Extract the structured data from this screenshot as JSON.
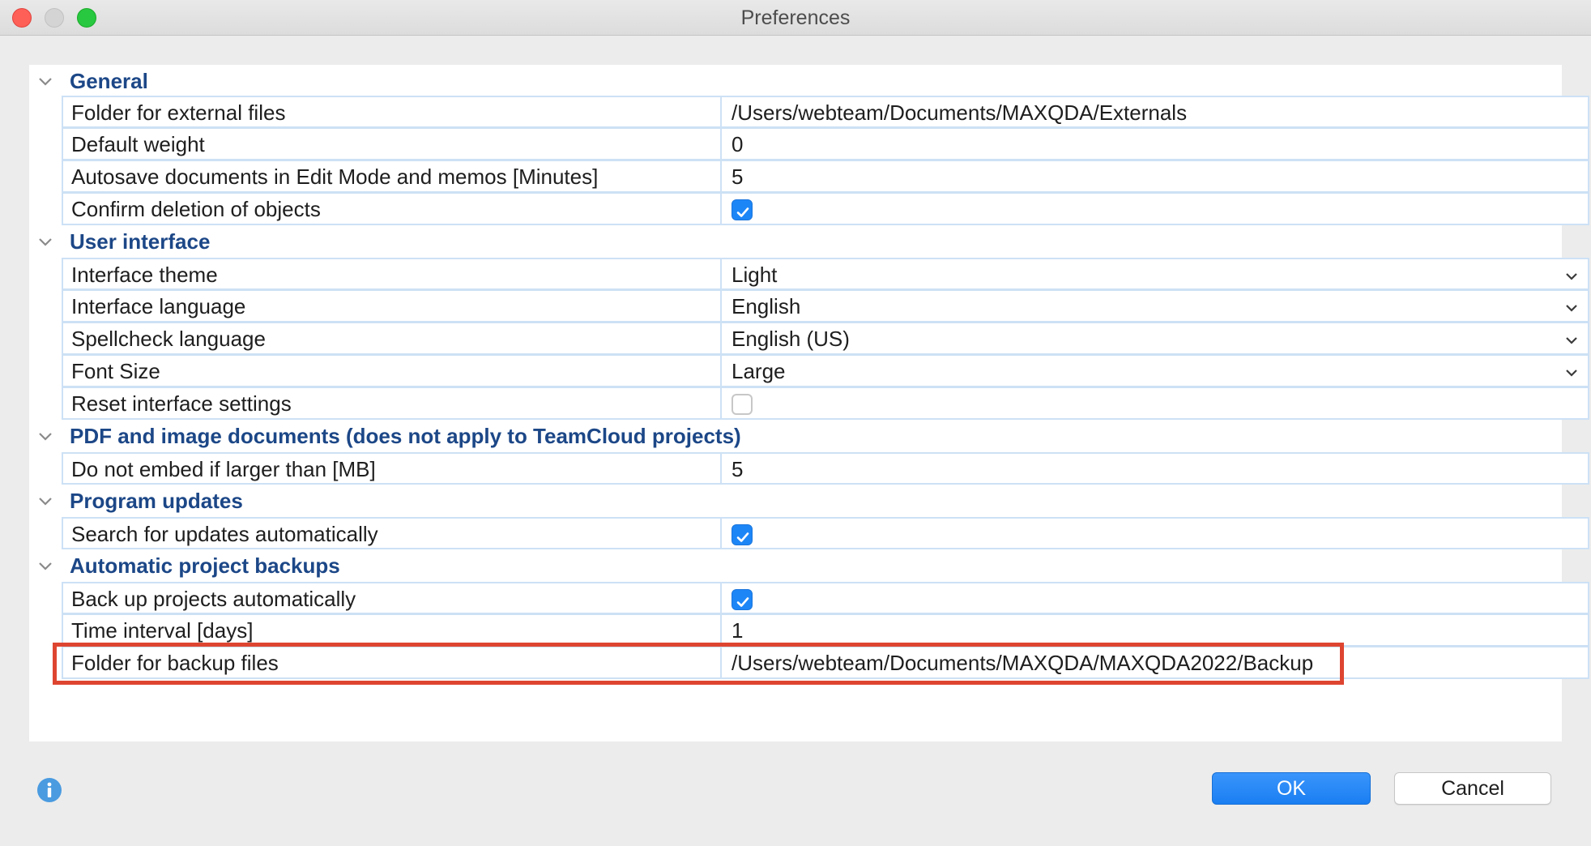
{
  "window": {
    "title": "Preferences"
  },
  "sections": {
    "general": {
      "title": "General",
      "rows": [
        {
          "label": "Folder for external files",
          "value": "/Users/webteam/Documents/MAXQDA/Externals"
        },
        {
          "label": "Default weight",
          "value": "0"
        },
        {
          "label": "Autosave documents in Edit Mode and memos [Minutes]",
          "value": "5"
        },
        {
          "label": "Confirm deletion of objects",
          "checked": true
        }
      ]
    },
    "user_interface": {
      "title": "User interface",
      "rows": [
        {
          "label": "Interface theme",
          "value": "Light"
        },
        {
          "label": "Interface language",
          "value": "English"
        },
        {
          "label": "Spellcheck language",
          "value": "English (US)"
        },
        {
          "label": "Font Size",
          "value": "Large"
        },
        {
          "label": "Reset interface settings",
          "checked": false
        }
      ]
    },
    "pdf": {
      "title": "PDF and image documents (does not apply to TeamCloud projects)",
      "rows": [
        {
          "label": "Do not embed if larger than [MB]",
          "value": "5"
        }
      ]
    },
    "updates": {
      "title": "Program updates",
      "rows": [
        {
          "label": "Search for updates automatically",
          "checked": true
        }
      ]
    },
    "backups": {
      "title": "Automatic project backups",
      "rows": [
        {
          "label": "Back up projects automatically",
          "checked": true
        },
        {
          "label": "Time interval [days]",
          "value": "1"
        },
        {
          "label": "Folder for backup files",
          "value": "/Users/webteam/Documents/MAXQDA/MAXQDA2022/Backup"
        }
      ]
    }
  },
  "buttons": {
    "ok": "OK",
    "cancel": "Cancel"
  },
  "colors": {
    "section_title": "#1c4787",
    "grid_line": "#cde1f5",
    "checkbox_checked": "#1d86f7",
    "highlight": "#de4531",
    "ok_button": "#1a7ef2"
  }
}
